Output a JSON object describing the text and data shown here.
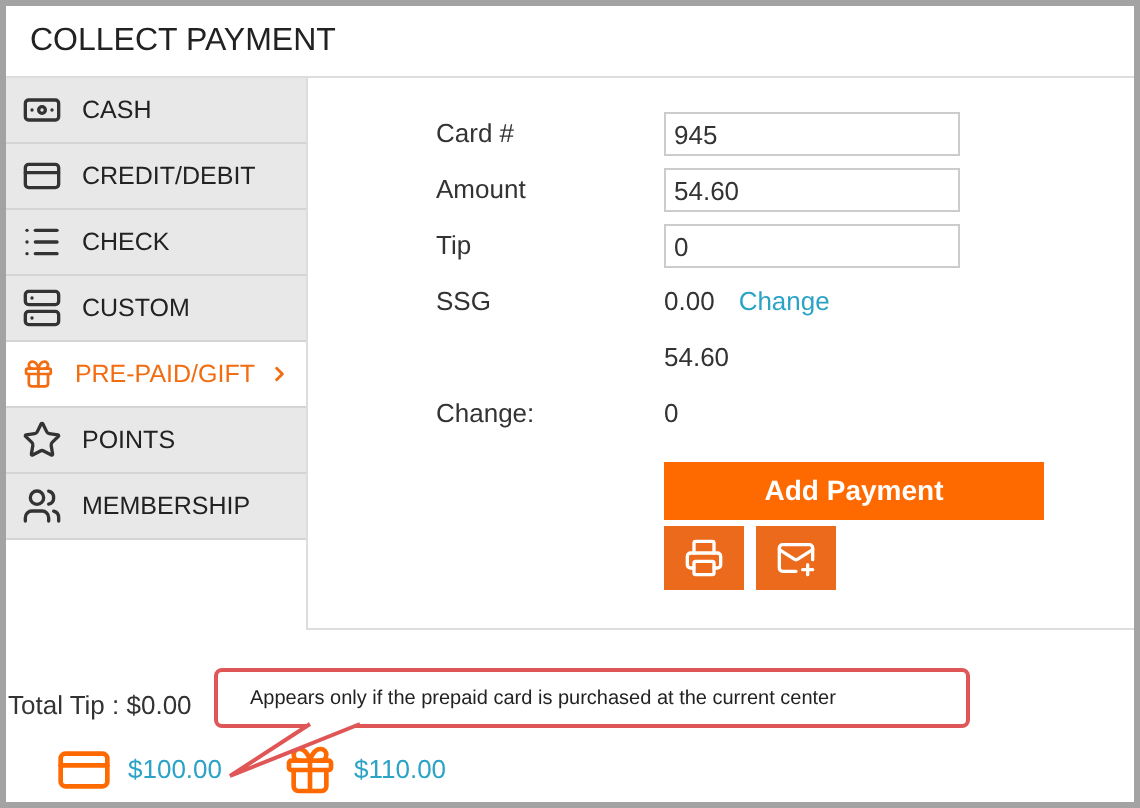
{
  "window": {
    "title": "COLLECT PAYMENT"
  },
  "sidebar": {
    "items": [
      {
        "kind": "cash",
        "label": "CASH",
        "selected": false
      },
      {
        "kind": "card",
        "label": "CREDIT/DEBIT",
        "selected": false
      },
      {
        "kind": "check",
        "label": "CHECK",
        "selected": false
      },
      {
        "kind": "custom",
        "label": "CUSTOM",
        "selected": false
      },
      {
        "kind": "gift",
        "label": "PRE-PAID/GIFT",
        "selected": true
      },
      {
        "kind": "points",
        "label": "POINTS",
        "selected": false
      },
      {
        "kind": "membership",
        "label": "MEMBERSHIP",
        "selected": false
      }
    ]
  },
  "form": {
    "fields": [
      {
        "label": "Card #",
        "value": "945"
      },
      {
        "label": "Amount",
        "value": "54.60"
      },
      {
        "label": "Tip",
        "value": "0"
      }
    ],
    "ssg": {
      "label": "SSG",
      "value": "0.00",
      "link": "Change"
    },
    "total": "54.60",
    "change": {
      "label": "Change:",
      "value": "0"
    },
    "primary_button": "Add Payment"
  },
  "footer": {
    "total_tip": "Total Tip : $0.00",
    "cards": [
      {
        "kind": "card",
        "amount": "$100.00"
      },
      {
        "kind": "gift",
        "amount": "$110.00"
      }
    ],
    "callout": "Appears only if the prepaid card is purchased at the current center"
  }
}
